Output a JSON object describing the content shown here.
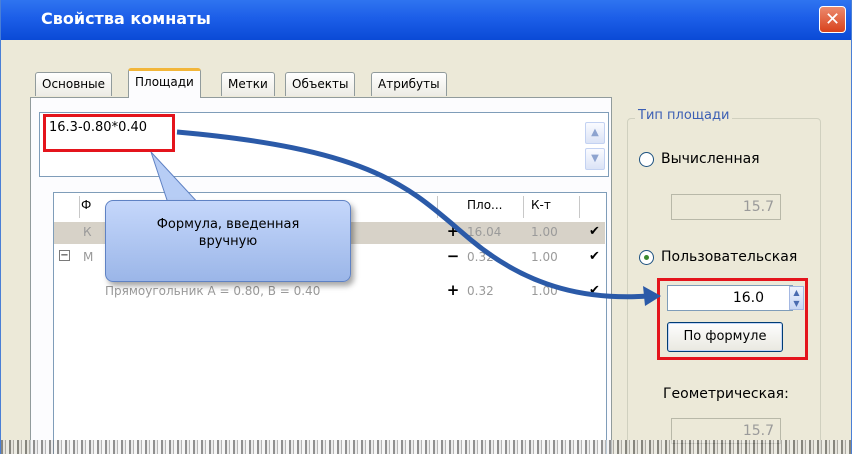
{
  "window": {
    "title": "Свойства комнаты",
    "close_icon": "close-icon"
  },
  "tabs": [
    {
      "label": "Основные",
      "active": false
    },
    {
      "label": "Площади",
      "active": true
    },
    {
      "label": "Метки",
      "active": false
    },
    {
      "label": "Объекты",
      "active": false
    },
    {
      "label": "Атрибуты",
      "active": false
    }
  ],
  "formula": {
    "value": "16.3-0.80*0.40"
  },
  "table": {
    "headers": [
      "Ф",
      "Пло...",
      "К-т"
    ],
    "rows": [
      {
        "name": "К",
        "sign": "+",
        "area": "16.04",
        "coef": "1.00",
        "checked": "✔"
      },
      {
        "name": "М",
        "sign": "−",
        "area": "0.32",
        "coef": "1.00",
        "checked": "✔"
      },
      {
        "name": "Прямоугольник А = 0.80, В = 0.40",
        "sign": "+",
        "area": "0.32",
        "coef": "1.00",
        "checked": "✔"
      }
    ]
  },
  "callout": {
    "line1": "Формула, введенная",
    "line2": "вручную"
  },
  "area_type": {
    "group_title": "Тип площади",
    "computed_label": "Вычисленная",
    "computed_value": "15.7",
    "custom_label": "Пользовательская",
    "custom_value": "16.0",
    "formula_button": "По формуле",
    "geometric_label": "Геометрическая:",
    "geometric_value": "15.7",
    "selected": "custom"
  },
  "colors": {
    "highlight": "#e4141c",
    "callout_fill": "#b7cdf5",
    "arrow": "#2b5aa8"
  }
}
